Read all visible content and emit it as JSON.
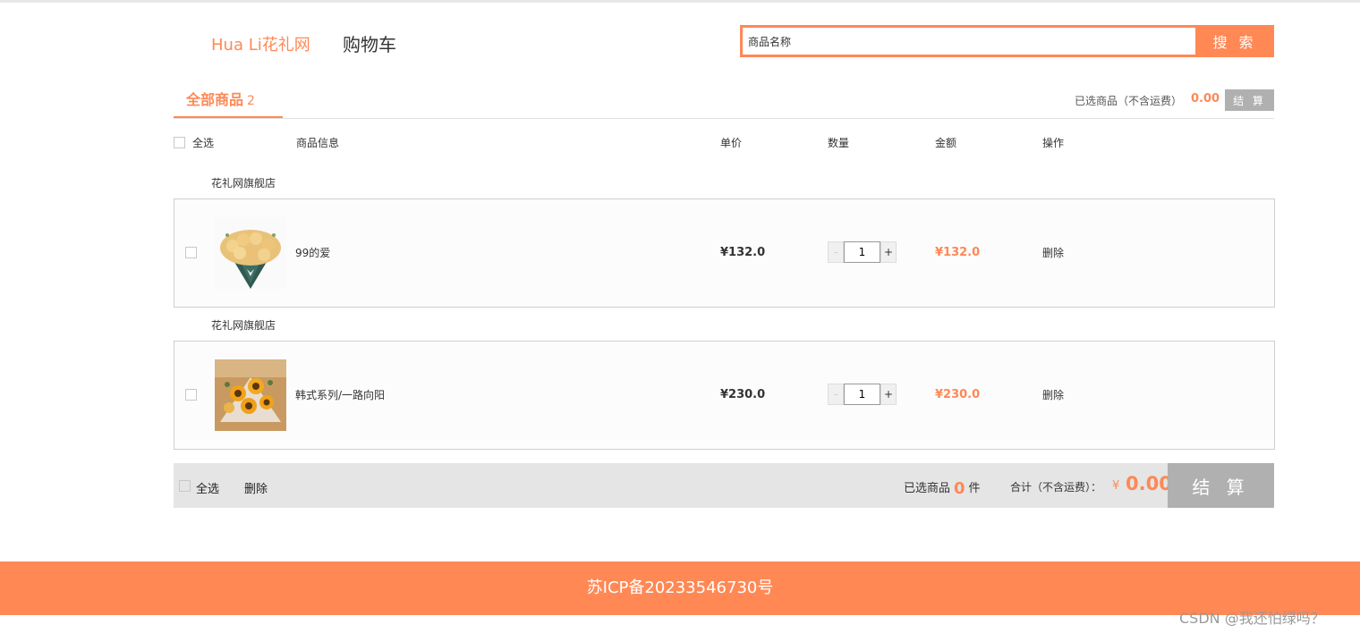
{
  "header": {
    "brand": "Hua Li花礼网",
    "title": "购物车",
    "search_placeholder": "商品名称",
    "search_button": "搜 索"
  },
  "tabs": {
    "all_label": "全部商品",
    "all_count": "2",
    "selected_label": "已选商品（不含运费）",
    "selected_total": "0.00",
    "checkout_button": "结 算"
  },
  "columns": {
    "select_all": "全选",
    "info": "商品信息",
    "price": "单价",
    "quantity": "数量",
    "amount": "金额",
    "action": "操作"
  },
  "items": [
    {
      "shop": "花礼网旗舰店",
      "name": "99的爱",
      "price": "¥132.0",
      "qty": "1",
      "amount": "¥132.0",
      "delete": "删除",
      "minus": "-",
      "plus": "+"
    },
    {
      "shop": "花礼网旗舰店",
      "name": "韩式系列/一路向阳",
      "price": "¥230.0",
      "qty": "1",
      "amount": "¥230.0",
      "delete": "删除",
      "minus": "-",
      "plus": "+"
    }
  ],
  "bottom": {
    "select_all": "全选",
    "delete": "删除",
    "selected_prefix": "已选商品",
    "selected_count": "0",
    "selected_suffix": "件",
    "total_label": "合计（不含运费）：",
    "yen": "¥",
    "total": "0.00",
    "checkout_button": "结 算"
  },
  "footer": {
    "icp": "苏ICP备20233546730号"
  },
  "watermark": "CSDN @我还怕绿吗？",
  "colors": {
    "accent": "#ff8855",
    "disabled_button": "#b0b0b0",
    "bottom_bar": "#e5e5e5"
  }
}
